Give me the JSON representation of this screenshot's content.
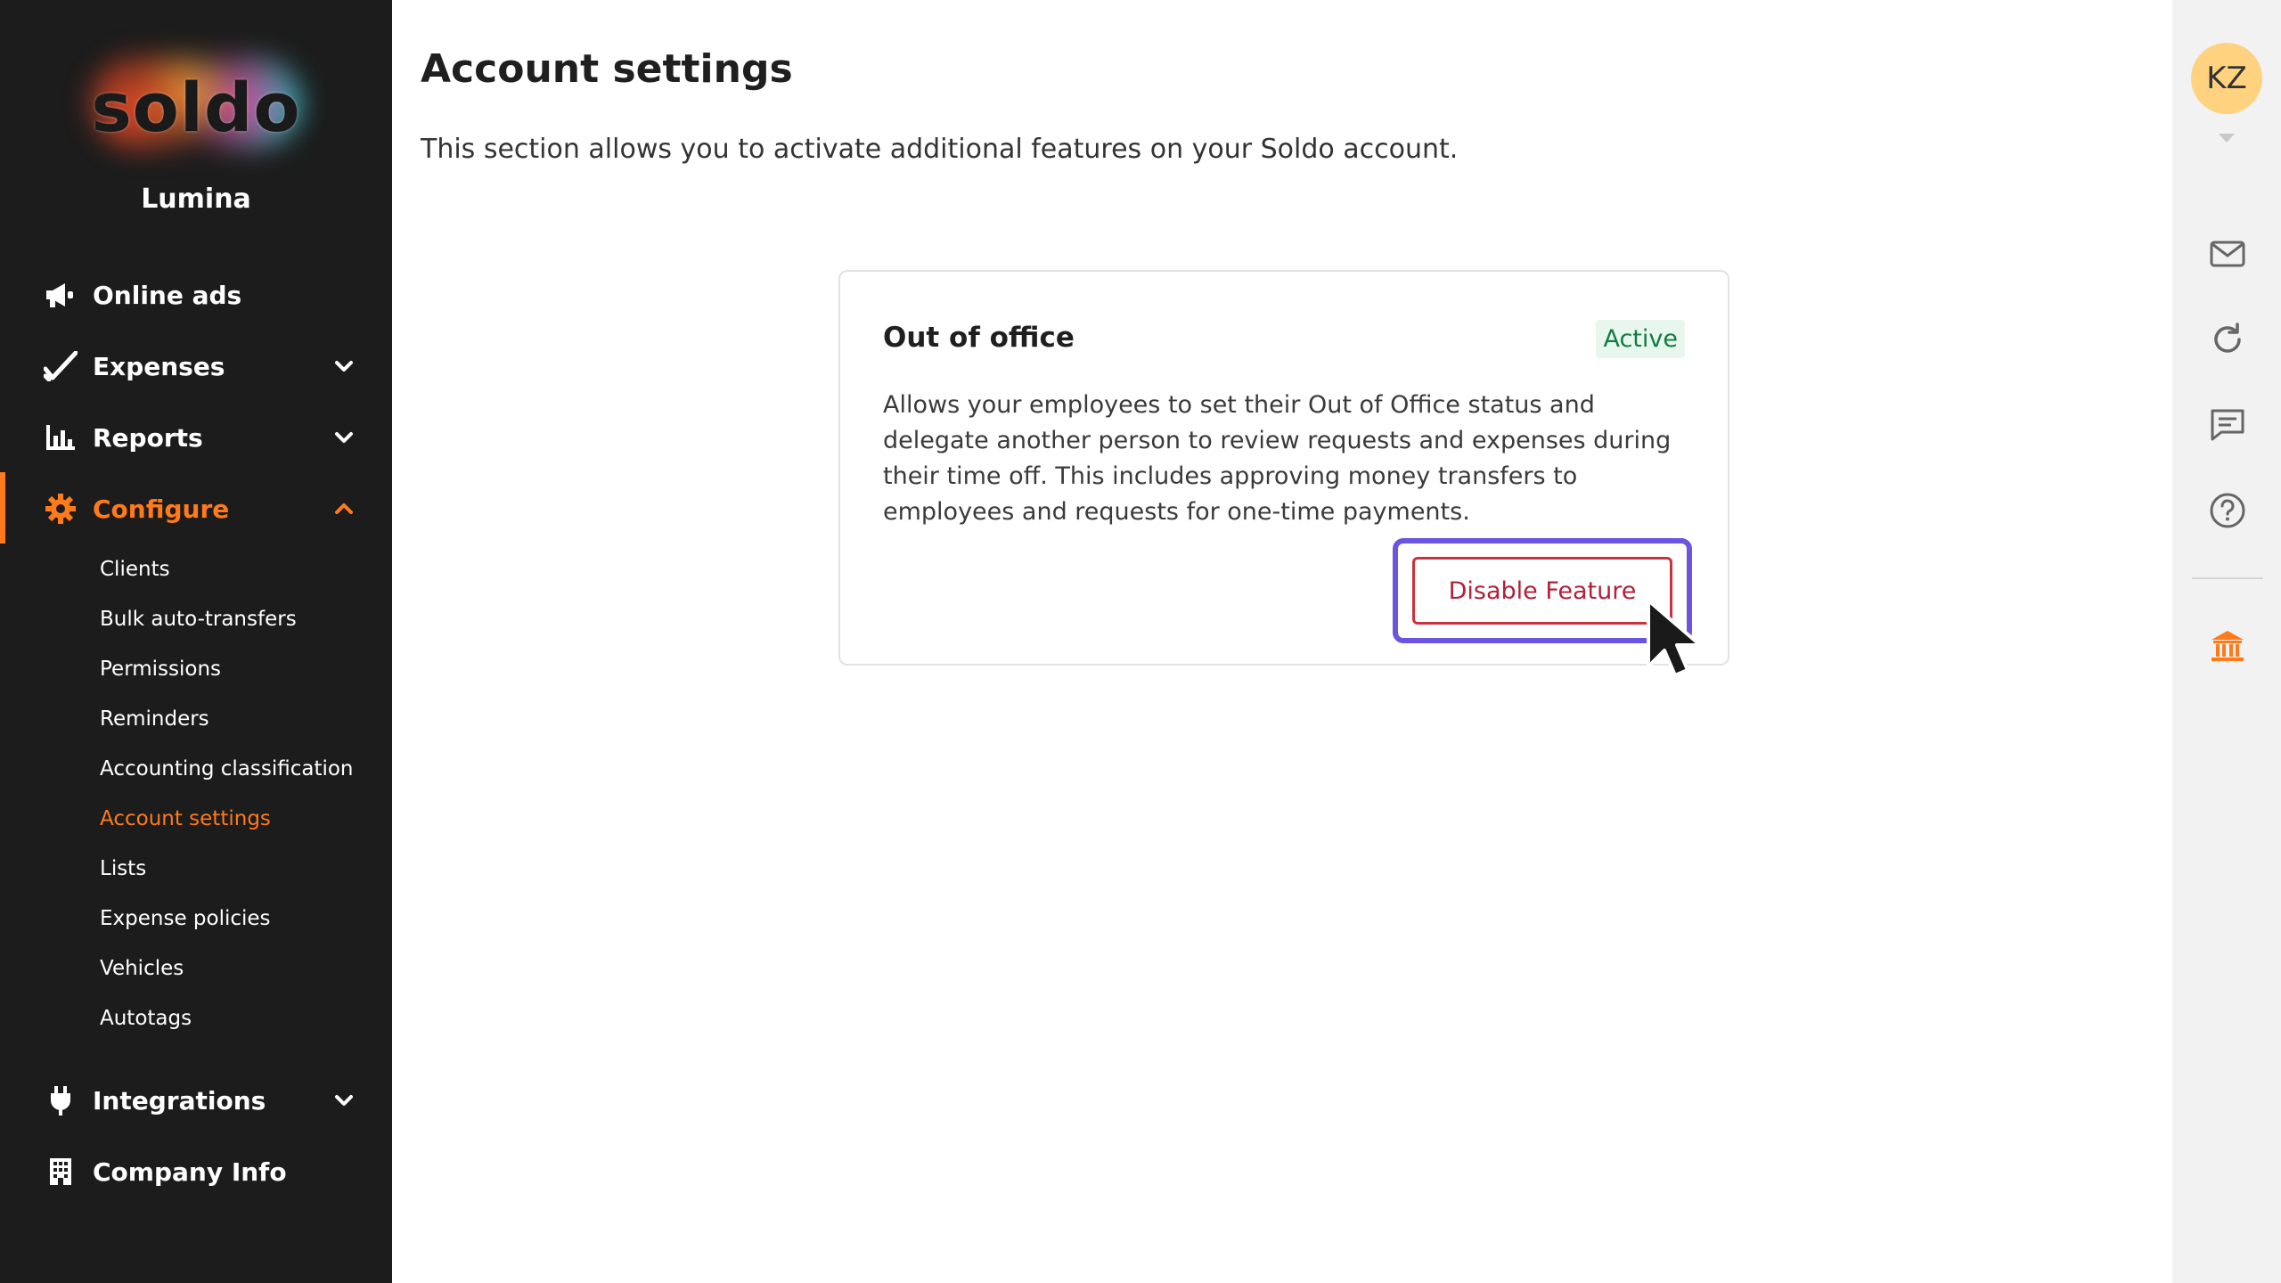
{
  "brand": {
    "logo_text": "soldo",
    "org_name": "Lumina",
    "accent": "#ff7a1a"
  },
  "sidebar": {
    "items": [
      {
        "label": "Online ads",
        "icon": "megaphone-icon"
      },
      {
        "label": "Expenses",
        "icon": "check-icon"
      },
      {
        "label": "Reports",
        "icon": "bar-chart-icon"
      },
      {
        "label": "Configure",
        "icon": "gear-icon"
      },
      {
        "label": "Integrations",
        "icon": "plug-icon"
      },
      {
        "label": "Company Info",
        "icon": "building-icon"
      }
    ],
    "configure_sub": [
      "Clients",
      "Bulk auto-transfers",
      "Permissions",
      "Reminders",
      "Accounting classification",
      "Account settings",
      "Lists",
      "Expense policies",
      "Vehicles",
      "Autotags"
    ]
  },
  "main": {
    "title": "Account settings",
    "description": "This section allows you to activate additional features on your Soldo account.",
    "card": {
      "title": "Out of office",
      "status": "Active",
      "body": "Allows your employees to set their Out of Office status and delegate another person to review requests and expenses during their time off. This includes approving money transfers to employees and requests for one-time payments.",
      "button": "Disable Feature"
    }
  },
  "rail": {
    "avatar_initials": "KZ",
    "icons": [
      "mail-icon",
      "refresh-icon",
      "chat-icon",
      "help-icon",
      "bank-icon"
    ]
  }
}
